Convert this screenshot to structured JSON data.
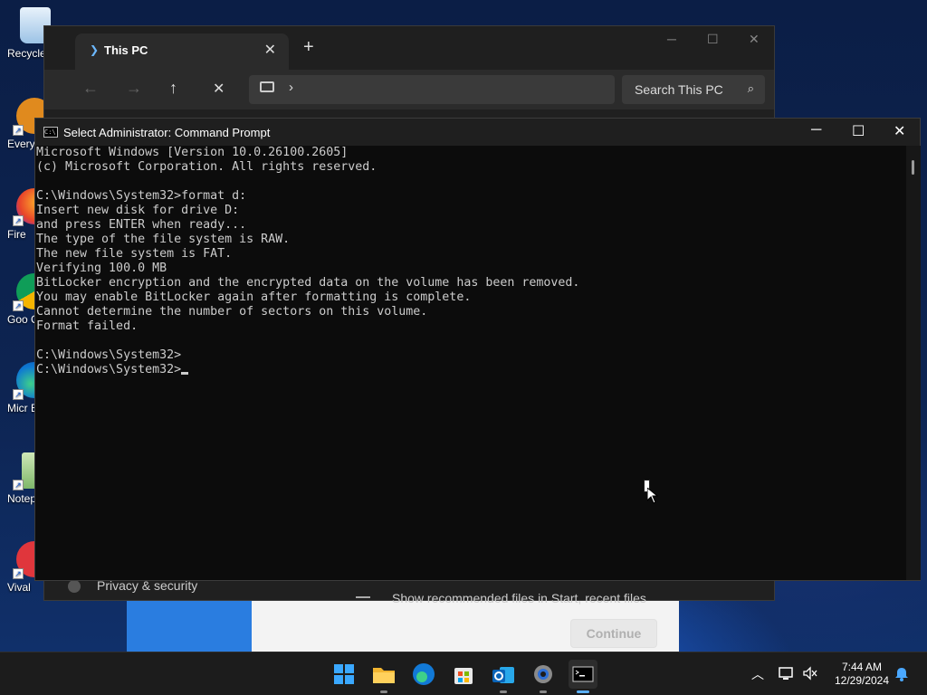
{
  "desktop": {
    "icons": [
      {
        "label": "Recycle",
        "icon": "recycle-bin-icon"
      },
      {
        "label": "Every",
        "icon": "everything-icon"
      },
      {
        "label": "Fire",
        "icon": "firefox-icon"
      },
      {
        "label": "Goo Chro",
        "icon": "chrome-icon"
      },
      {
        "label": "Micr Ed",
        "icon": "edge-icon"
      },
      {
        "label": "Notep",
        "icon": "notepad-icon"
      },
      {
        "label": "Vival",
        "icon": "vivaldi-icon"
      }
    ]
  },
  "explorer": {
    "tab_label": "This PC",
    "tab_icon": "pc-folder-icon",
    "close_symbol": "✕",
    "newtab_symbol": "+",
    "search_placeholder": "Search This PC",
    "address_chevron": "›",
    "privacy_label": "Privacy & security",
    "recommended_label": "Show recommended files in Start, recent files"
  },
  "setup": {
    "continue_label": "Continue"
  },
  "cmd": {
    "title": "Select Administrator: Command Prompt",
    "icon_text": "C:\\",
    "lines": [
      "Microsoft Windows [Version 10.0.26100.2605]",
      "(c) Microsoft Corporation. All rights reserved.",
      "",
      "C:\\Windows\\System32>format d:",
      "Insert new disk for drive D:",
      "and press ENTER when ready...",
      "The type of the file system is RAW.",
      "The new file system is FAT.",
      "Verifying 100.0 MB",
      "BitLocker encryption and the encrypted data on the volume has been removed.",
      "You may enable BitLocker again after formatting is complete.",
      "Cannot determine the number of sectors on this volume.",
      "Format failed.",
      "",
      "C:\\Windows\\System32>"
    ],
    "prompt": "C:\\Windows\\System32>",
    "minimize_symbol": "─",
    "maximize_symbol": "☐",
    "close_symbol": "✕"
  },
  "taskbar": {
    "apps": [
      "start-icon",
      "file-explorer-icon",
      "edge-icon",
      "store-icon",
      "outlook-icon",
      "settings-icon",
      "terminal-icon"
    ],
    "time": "7:44 AM",
    "date": "12/29/2024"
  },
  "colors": {
    "cmd_text": "#cccccc",
    "cmd_bg": "#0c0c0c",
    "accent": "#5ab0ff"
  }
}
